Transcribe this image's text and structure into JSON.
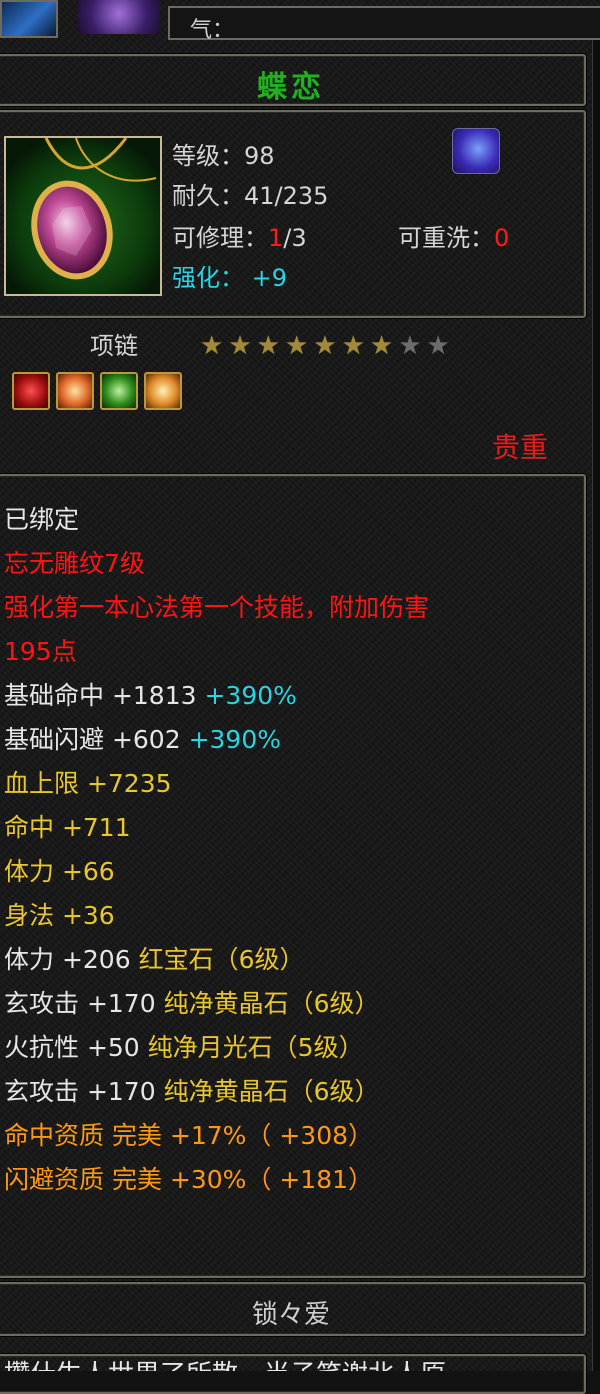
{
  "header": {
    "qi_label": "气："
  },
  "item": {
    "name": "蝶恋",
    "level_label": "等级：98",
    "durability_label": "耐久：41/235",
    "repair_prefix": "可修理：",
    "repair_used": "1",
    "repair_total": "/3",
    "rewash_prefix": "可重洗：",
    "rewash_value": "0",
    "enhance_label": "强化：",
    "enhance_value": "+9",
    "type": "项链",
    "stars_total": 9,
    "stars_lit": 7,
    "rarity": "贵重",
    "gem_slots": [
      "red-gem-icon",
      "orange-gem-icon",
      "green-gem-icon",
      "yellow-gem-icon"
    ]
  },
  "details": [
    {
      "parts": [
        "已绑定"
      ],
      "colors": [
        "white"
      ]
    },
    {
      "parts": [
        "忘无雕纹7级"
      ],
      "colors": [
        "red2"
      ]
    },
    {
      "parts": [
        "强化第一本心法第一个技能，附加伤害"
      ],
      "colors": [
        "red2"
      ]
    },
    {
      "parts": [
        "195点"
      ],
      "colors": [
        "red2"
      ]
    },
    {
      "parts": [
        "基础命中  +1813 ",
        "+390%"
      ],
      "colors": [
        "white",
        "cyan"
      ]
    },
    {
      "parts": [
        "基础闪避  +602 ",
        "+390%"
      ],
      "colors": [
        "white",
        "cyan"
      ]
    },
    {
      "parts": [
        "血上限  +7235"
      ],
      "colors": [
        "yellow"
      ]
    },
    {
      "parts": [
        "命中  +711"
      ],
      "colors": [
        "yellow"
      ]
    },
    {
      "parts": [
        "体力  +66"
      ],
      "colors": [
        "yellow"
      ]
    },
    {
      "parts": [
        "身法  +36"
      ],
      "colors": [
        "yellow"
      ]
    },
    {
      "parts": [
        "体力  +206 ",
        "红宝石（6级）"
      ],
      "colors": [
        "white",
        "yellow"
      ]
    },
    {
      "parts": [
        "玄攻击  +170 ",
        "纯净黄晶石（6级）"
      ],
      "colors": [
        "white",
        "yellow"
      ]
    },
    {
      "parts": [
        "火抗性  +50 ",
        "纯净月光石（5级）"
      ],
      "colors": [
        "white",
        "yellow"
      ]
    },
    {
      "parts": [
        "玄攻击  +170 ",
        "纯净黄晶石（6级）"
      ],
      "colors": [
        "white",
        "yellow"
      ]
    },
    {
      "parts": [
        "命中资质    完美 +17%（ +308）"
      ],
      "colors": [
        "orange"
      ]
    },
    {
      "parts": [
        "闪避资质    完美 +30%（ +181）"
      ],
      "colors": [
        "orange"
      ]
    }
  ],
  "footer": {
    "title": "锁々爱",
    "text": "攒什生人世界了所散，当子笑谢北人原"
  },
  "colors": {
    "name_green": "#21b020",
    "cyan": "#2ad4e0",
    "red": "#ff1414",
    "yellow": "#e8c62c",
    "orange": "#ff9914",
    "frame": "#6e6a5c"
  }
}
